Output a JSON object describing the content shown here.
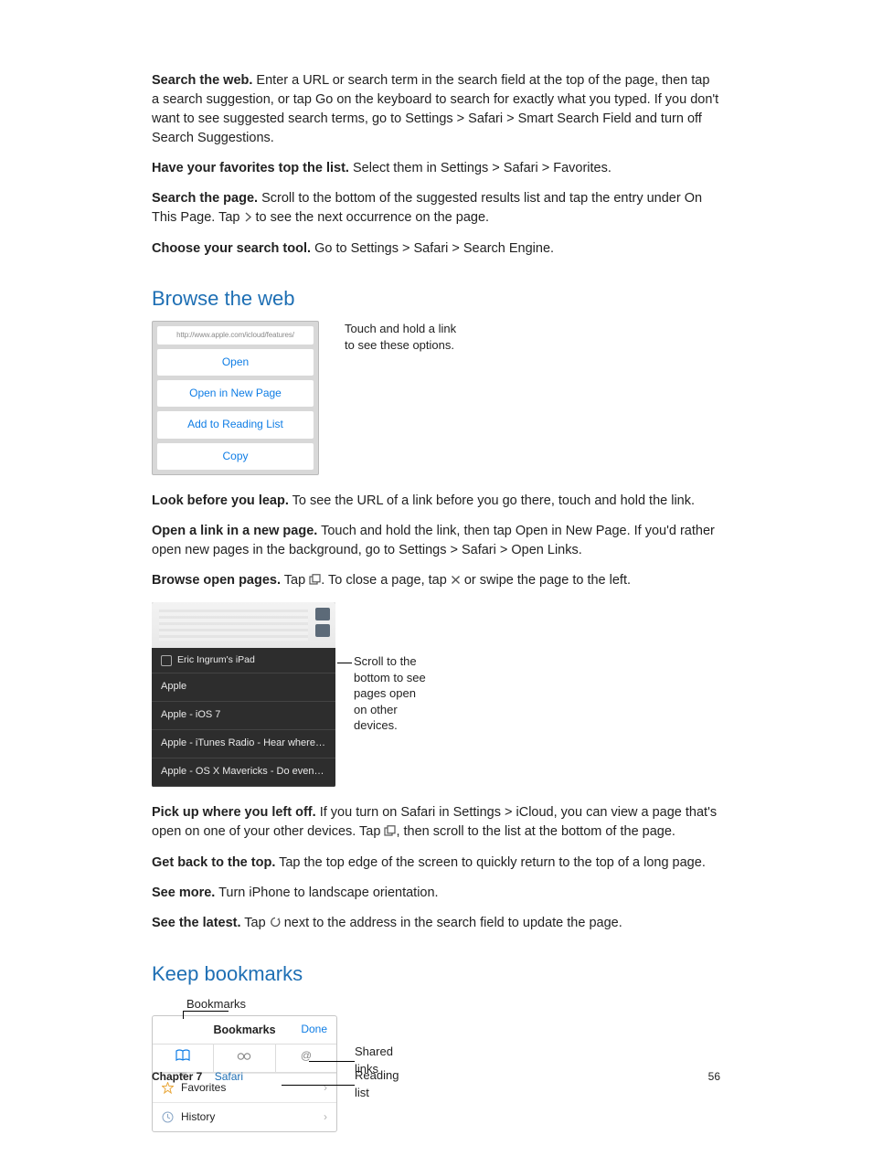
{
  "p1": {
    "lead": "Search the web.",
    "body": " Enter a URL or search term in the search field at the top of the page, then tap a search suggestion, or tap Go on the keyboard to search for exactly what you typed. If you don't want to see suggested search terms, go to Settings > Safari > Smart Search Field and turn off Search Suggestions."
  },
  "p2": {
    "lead": "Have your favorites top the list.",
    "body": " Select them in Settings > Safari > Favorites."
  },
  "p3": {
    "lead": "Search the page.",
    "body": " Scroll to the bottom of the suggested results list and tap the entry under On This Page. Tap ",
    "tail": " to see the next occurrence on the page."
  },
  "p4": {
    "lead": "Choose your search tool.",
    "body": " Go to Settings > Safari > Search Engine."
  },
  "h_browse": "Browse the web",
  "fig1": {
    "url": "http://www.apple.com/icloud/features/",
    "open": "Open",
    "new": "Open in New Page",
    "rl": "Add to Reading List",
    "copy": "Copy",
    "caption1": "Touch and hold a link",
    "caption2": "to see these options."
  },
  "p5": {
    "lead": "Look before you leap.",
    "body": " To see the URL of a link before you go there, touch and hold the link."
  },
  "p6": {
    "lead": "Open a link in a new page.",
    "body": " Touch and hold the link, then tap Open in New Page. If you'd rather open new pages in the background, go to Settings > Safari > Open Links."
  },
  "p7": {
    "lead": "Browse open pages.",
    "body1": " Tap ",
    "body2": ". To close a page, tap ",
    "body3": " or swipe the page to the left."
  },
  "fig2": {
    "device": "Eric Ingrum's iPad",
    "row1": "Apple",
    "row2": "Apple - iOS 7",
    "row3": "Apple - iTunes Radio - Hear where…",
    "row4": "Apple - OS X Mavericks - Do even…",
    "caption": "Scroll to the\nbottom to see\npages open\non other\ndevices."
  },
  "p8": {
    "lead": "Pick up where you left off.",
    "body1": " If you turn on Safari in Settings > iCloud, you can view a page that's open on one of your other devices. Tap ",
    "body2": ", then scroll to the list at the bottom of the page."
  },
  "p9": {
    "lead": "Get back to the top.",
    "body": " Tap the top edge of the screen to quickly return to the top of a long page."
  },
  "p10": {
    "lead": "See more.",
    "body": " Turn iPhone to landscape orientation."
  },
  "p11": {
    "lead": "See the latest.",
    "body1": " Tap ",
    "body2": " next to the address in the search field to update the page."
  },
  "h_bookmarks": "Keep bookmarks",
  "fig3": {
    "top_label": "Bookmarks",
    "title": "Bookmarks",
    "done": "Done",
    "favorites": "Favorites",
    "history": "History",
    "shared": "Shared links",
    "reading": "Reading list"
  },
  "footer": {
    "chapter_label": "Chapter  7",
    "chapter_name": "Safari",
    "page": "56"
  }
}
